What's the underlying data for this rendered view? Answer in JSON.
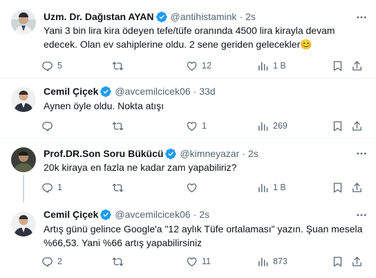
{
  "tweets": [
    {
      "name": "Uzm. Dr. Dağıstan AYAN",
      "handle": "@antihistamink",
      "time": "2s",
      "text_lines": [
        "Yani 3 bin lira kira ödeyen tefe/tüfe oranında 4500 lira kirayla devam",
        "edecek. Olan ev sahiplerine oldu. 2 sene geriden gelecekler"
      ],
      "emoji": "😊",
      "replies": "5",
      "retweets": "",
      "likes": "12",
      "views": "1 B"
    },
    {
      "name": "Cemil Çiçek",
      "handle": "@avcemilcicek06",
      "time": "33d",
      "text_lines": [
        "Aynen öyle oldu. Nokta atışı"
      ],
      "replies": "",
      "retweets": "",
      "likes": "1",
      "views": "269"
    },
    {
      "name": "Prof.DR.Son Soru Bükücü",
      "handle": "@kimneyazar",
      "time": "2s",
      "text_lines": [
        "20k kiraya en fazla ne kadar zam yapabiliriz?"
      ],
      "replies": "1",
      "retweets": "",
      "likes": "",
      "views": "1 B"
    },
    {
      "name": "Cemil Çiçek",
      "handle": "@avcemilcicek06",
      "time": "2s",
      "text_lines": [
        "Artış günü gelince Google'a \"12 aylık Tüfe ortalaması\" yazın. Şuan mesela",
        "%66,53. Yani %66 artış yapabilirsiniz"
      ],
      "replies": "2",
      "retweets": "",
      "likes": "11",
      "views": "873"
    }
  ],
  "separator": "·",
  "icons": {
    "verified": "verified-badge-icon",
    "more": "more-icon",
    "reply": "reply-icon",
    "retweet": "retweet-icon",
    "like": "heart-icon",
    "views": "views-icon",
    "bookmark": "bookmark-icon",
    "share": "share-icon"
  },
  "colors": {
    "verified": "#1d9bf0",
    "text": "#0f1419",
    "muted": "#536471",
    "divider": "#eff3f4"
  }
}
